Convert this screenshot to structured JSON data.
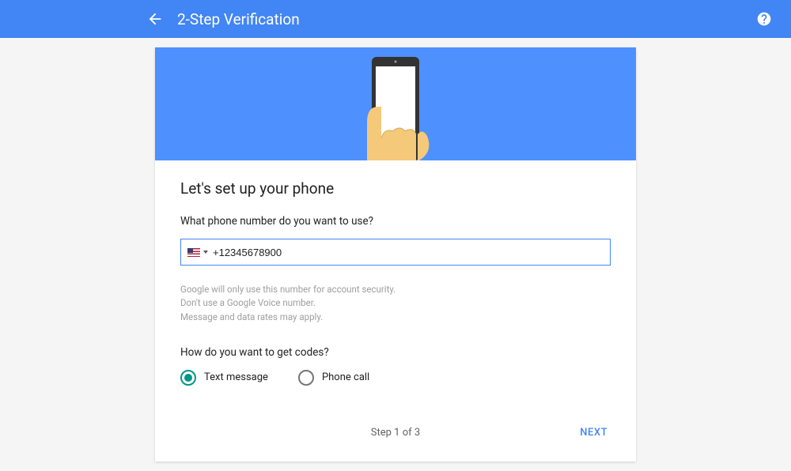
{
  "header": {
    "title": "2-Step Verification"
  },
  "card": {
    "heading": "Let's set up your phone",
    "phone_label": "What phone number do you want to use?",
    "phone_value": "+12345678900",
    "disclaimer_line1": "Google will only use this number for account security.",
    "disclaimer_line2": "Don't use a Google Voice number.",
    "disclaimer_line3": "Message and data rates may apply.",
    "codes_label": "How do you want to get codes?",
    "options": {
      "text_message": "Text message",
      "phone_call": "Phone call"
    },
    "selected_option": "text_message",
    "step_indicator": "Step 1 of 3",
    "next_label": "NEXT"
  }
}
